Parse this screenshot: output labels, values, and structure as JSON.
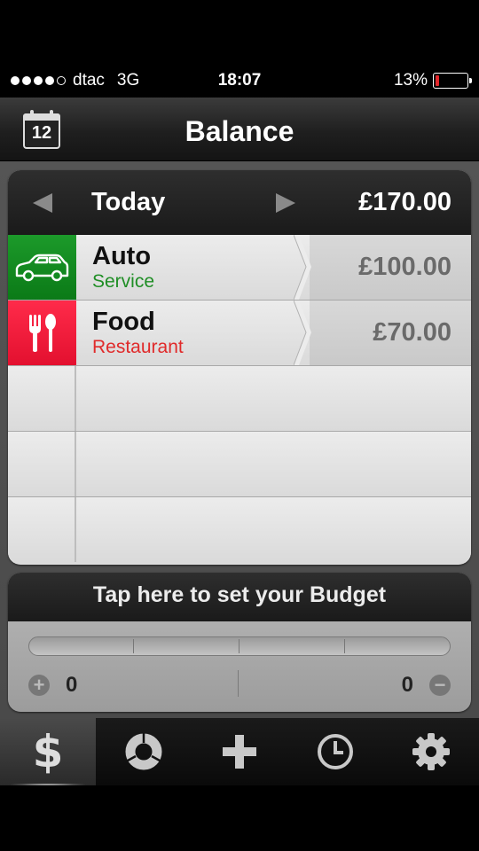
{
  "status_bar": {
    "carrier": "dtac",
    "network": "3G",
    "time": "18:07",
    "battery": "13%",
    "signal_bars": 4,
    "battery_level": 0.13
  },
  "nav": {
    "title": "Balance",
    "calendar_day": "12"
  },
  "period": {
    "label": "Today",
    "total": "£170.00"
  },
  "entries": [
    {
      "category": "Auto",
      "subcategory": "Service",
      "amount": "£100.00",
      "icon": "car-icon",
      "color": "#0b8a1c"
    },
    {
      "category": "Food",
      "subcategory": "Restaurant",
      "amount": "£70.00",
      "icon": "fork-spoon-icon",
      "color": "#f01a3a"
    }
  ],
  "budget": {
    "prompt": "Tap here to set your Budget",
    "left_value": "0",
    "right_value": "0"
  },
  "tabs": [
    {
      "name": "balance",
      "icon": "dollar-icon",
      "glyph": "$",
      "active": true
    },
    {
      "name": "report",
      "icon": "pie-chart-icon",
      "active": false
    },
    {
      "name": "add",
      "icon": "plus-icon",
      "active": false
    },
    {
      "name": "history",
      "icon": "clock-icon",
      "active": false
    },
    {
      "name": "settings",
      "icon": "gear-icon",
      "active": false
    }
  ]
}
